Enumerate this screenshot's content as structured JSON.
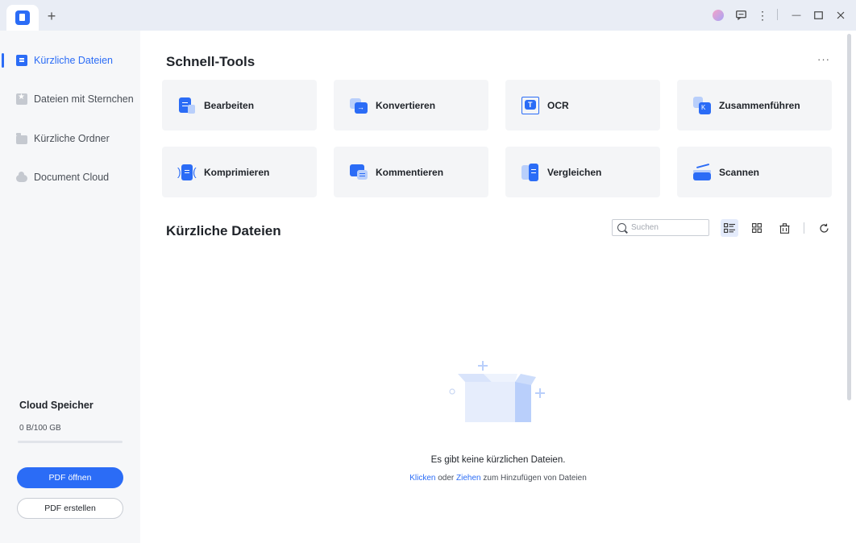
{
  "titlebar": {
    "new_tab": "+",
    "minimize": "—",
    "maximize": "☐",
    "close": "✕",
    "more": "⋮"
  },
  "sidebar": {
    "items": [
      {
        "label": "Kürzliche Dateien",
        "icon": "recent-files-icon",
        "active": true
      },
      {
        "label": "Dateien mit Sternchen",
        "icon": "star-icon",
        "active": false
      },
      {
        "label": "Kürzliche Ordner",
        "icon": "folder-icon",
        "active": false
      },
      {
        "label": "Document Cloud",
        "icon": "cloud-icon",
        "active": false
      }
    ],
    "cloud": {
      "title": "Cloud Speicher",
      "usage": "0 B/100 GB",
      "used_fraction": 0
    },
    "open_pdf_label": "PDF öffnen",
    "create_pdf_label": "PDF erstellen"
  },
  "quick_tools": {
    "title": "Schnell-Tools",
    "more": "···",
    "tools": [
      {
        "label": "Bearbeiten",
        "icon": "edit-icon"
      },
      {
        "label": "Konvertieren",
        "icon": "convert-icon"
      },
      {
        "label": "OCR",
        "icon": "ocr-icon"
      },
      {
        "label": "Zusammenführen",
        "icon": "merge-icon"
      },
      {
        "label": "Komprimieren",
        "icon": "compress-icon"
      },
      {
        "label": "Kommentieren",
        "icon": "comment-icon"
      },
      {
        "label": "Vergleichen",
        "icon": "compare-icon"
      },
      {
        "label": "Scannen",
        "icon": "scan-icon"
      }
    ]
  },
  "recent": {
    "title": "Kürzliche Dateien",
    "search_placeholder": "Suchen",
    "empty_text": "Es gibt keine kürzlichen Dateien.",
    "empty_click": "Klicken",
    "empty_or": " oder ",
    "empty_drag": "Ziehen",
    "empty_rest": " zum Hinzufügen von Dateien"
  },
  "colors": {
    "accent": "#2b6cf6",
    "sidebar_bg": "#f6f7f9",
    "titlebar_bg": "#e9edf5",
    "card_bg": "#f4f5f7"
  }
}
